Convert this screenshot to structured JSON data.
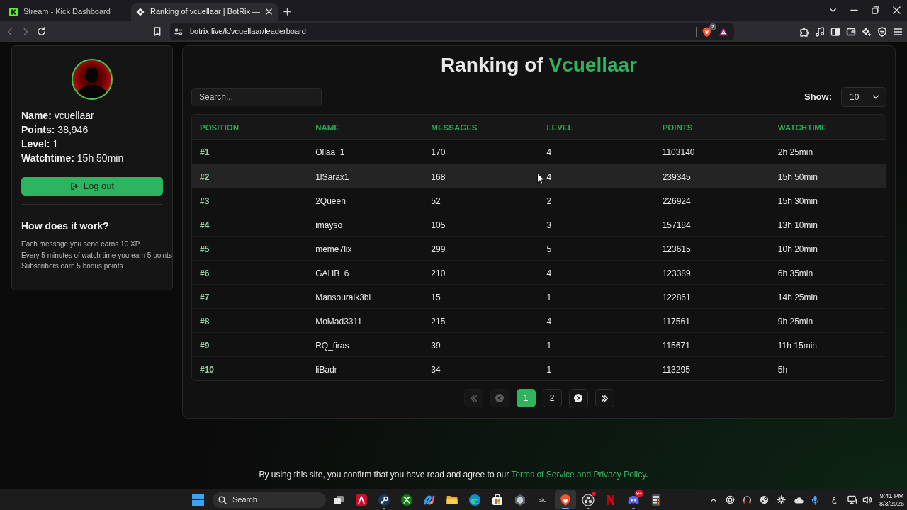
{
  "browser": {
    "tabs": [
      {
        "title": "Stream - Kick Dashboard",
        "selected": false
      },
      {
        "title": "Ranking of vcuellaar | BotRix —",
        "selected": true
      }
    ],
    "url": "botrix.live/k/vcuellaar/leaderboard",
    "shield_count": "2"
  },
  "profile": {
    "fields": [
      {
        "label": "Name:",
        "value": "vcuellaar"
      },
      {
        "label": "Points:",
        "value": "38,946"
      },
      {
        "label": "Level:",
        "value": "1"
      },
      {
        "label": "Watchtime:",
        "value": "15h 50min"
      }
    ],
    "logout": "Log out",
    "help_title": "How does it work?",
    "help_lines": [
      "Each message you send earns 10 XP",
      "Every 5 minutes of watch time you earn 5 points",
      "Subscribers earn 5 bonus points"
    ]
  },
  "leaderboard": {
    "title": "Ranking of",
    "title_highlight": "Vcuellaar",
    "search": {
      "placeholder": "Search..."
    },
    "show": {
      "label": "Show:",
      "value": "10"
    },
    "columns": [
      "POSITION",
      "NAME",
      "MESSAGES",
      "LEVEL",
      "POINTS",
      "WATCHTIME"
    ],
    "rows": [
      {
        "cells": [
          "#1",
          "Ollaa_1",
          "170",
          "4",
          "1103140",
          "2h 25min"
        ],
        "highlighted": false
      },
      {
        "cells": [
          "#2",
          "1lSarax1",
          "168",
          "4",
          "239345",
          "15h 50min"
        ],
        "highlighted": true
      },
      {
        "cells": [
          "#3",
          "2Queen",
          "52",
          "2",
          "226924",
          "15h 30min"
        ],
        "highlighted": false
      },
      {
        "cells": [
          "#4",
          "imayso",
          "105",
          "3",
          "157184",
          "13h 10min"
        ],
        "highlighted": false
      },
      {
        "cells": [
          "#5",
          "meme7lix",
          "299",
          "5",
          "123615",
          "10h 20min"
        ],
        "highlighted": false
      },
      {
        "cells": [
          "#6",
          "GAHB_6",
          "210",
          "4",
          "123389",
          "6h 35min"
        ],
        "highlighted": false
      },
      {
        "cells": [
          "#7",
          "Mansouralk3bi",
          "15",
          "1",
          "122861",
          "14h 25min"
        ],
        "highlighted": false
      },
      {
        "cells": [
          "#8",
          "MoMad3311",
          "215",
          "4",
          "117561",
          "9h 25min"
        ],
        "highlighted": false
      },
      {
        "cells": [
          "#9",
          "RQ_firas",
          "39",
          "1",
          "115671",
          "11h 15min"
        ],
        "highlighted": false
      },
      {
        "cells": [
          "#10",
          "liBadr",
          "34",
          "1",
          "113295",
          "5h"
        ],
        "highlighted": false
      }
    ],
    "pagination": [
      {
        "kind": "first",
        "disabled": true
      },
      {
        "kind": "prev",
        "disabled": true
      },
      {
        "kind": "page",
        "label": "1",
        "selected": true
      },
      {
        "kind": "page",
        "label": "2",
        "selected": false
      },
      {
        "kind": "next",
        "disabled": false
      },
      {
        "kind": "last",
        "disabled": false
      }
    ]
  },
  "footer": {
    "text": "By using this site, you confirm that you have read and agree to our",
    "link": "Terms of Service and Privacy Policy",
    "end": "."
  },
  "taskbar": {
    "search": "Search",
    "apps": [
      {
        "active": false,
        "running": false
      },
      {
        "active": false,
        "running": false
      },
      {
        "active": false,
        "running": true
      },
      {
        "active": false,
        "running": false
      },
      {
        "active": false,
        "running": false
      },
      {
        "active": false,
        "running": false
      },
      {
        "active": false,
        "running": false
      },
      {
        "active": false,
        "running": false
      },
      {
        "active": false,
        "running": false
      },
      {
        "label": "sio",
        "active": false,
        "running": false
      },
      {
        "active": true,
        "running": true
      },
      {
        "active": false,
        "running": true
      },
      {
        "active": false,
        "running": false
      },
      {
        "badge": "9+",
        "active": false,
        "running": true
      },
      {
        "active": false,
        "running": false
      }
    ],
    "language": "ع",
    "time": "9:41 PM",
    "date": "8/3/2026"
  }
}
